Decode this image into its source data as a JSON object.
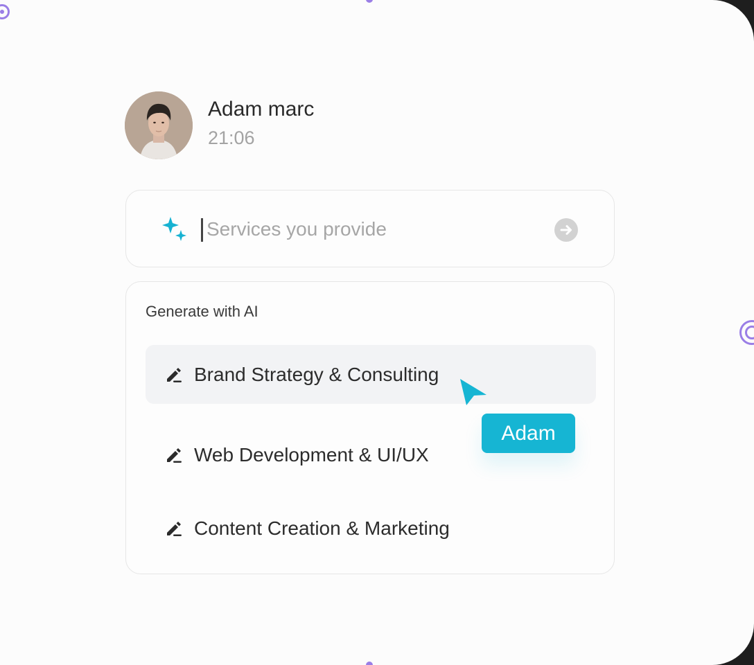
{
  "profile": {
    "name": "Adam marc",
    "time": "21:06",
    "avatar_icon": "user-photo"
  },
  "input": {
    "placeholder": "Services you provide",
    "value": "",
    "leading_icon": "sparkle-icon",
    "trailing_icon": "arrow-right-circle-icon"
  },
  "ai_panel": {
    "heading": "Generate with AI",
    "suggestions": [
      {
        "label": "Brand Strategy & Consulting",
        "icon": "pencil-icon",
        "highlighted": true
      },
      {
        "label": "Web Development & UI/UX",
        "icon": "pencil-icon",
        "highlighted": false
      },
      {
        "label": "Content Creation & Marketing",
        "icon": "pencil-icon",
        "highlighted": false
      }
    ]
  },
  "cursor": {
    "tag_label": "Adam",
    "color": "#16b5d3"
  },
  "colors": {
    "accent": "#16b5d3",
    "selection_handles": "#9a7ee6",
    "highlight_row": "#f2f3f5"
  }
}
